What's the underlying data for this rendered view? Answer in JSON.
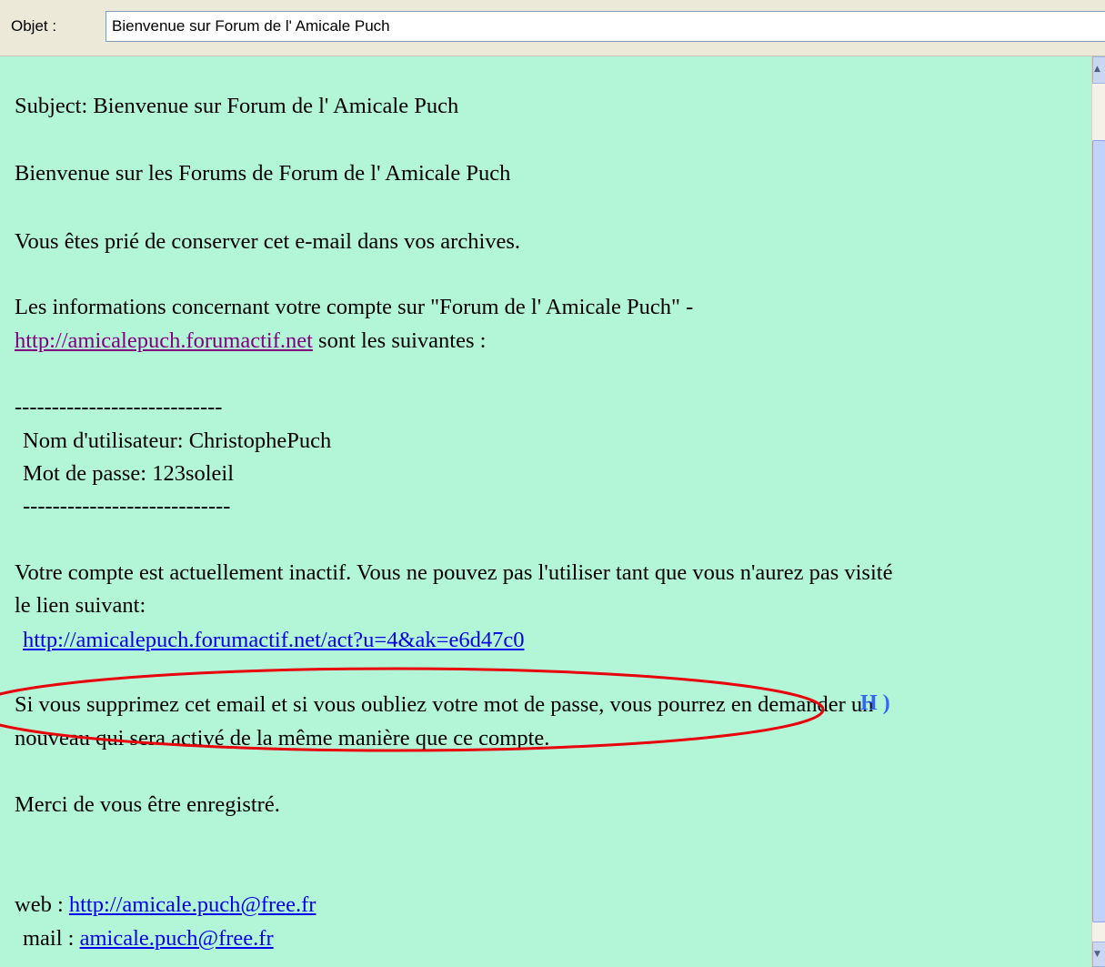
{
  "header": {
    "subject_label": "Objet :",
    "subject_value": "Bienvenue sur Forum de l' Amicale Puch"
  },
  "message": {
    "subject_line": "Subject: Bienvenue sur Forum de l' Amicale Puch",
    "welcome": "Bienvenue sur les Forums de Forum de l' Amicale Puch",
    "keep_notice": "Vous êtes prié de conserver cet e-mail dans vos archives.",
    "account_info_1": "Les informations concernant votre compte sur \"Forum de l' Amicale Puch\" -",
    "account_url": "http://amicalepuch.forumactif.net",
    "account_info_2": " sont les suivantes :",
    "separator_top": "----------------------------",
    "username_line": "Nom d'utilisateur: ChristophePuch",
    "password_line": "Mot de passe: 123soleil",
    "separator_bottom": "----------------------------",
    "inactive_1": "Votre compte est actuellement inactif. Vous ne pouvez pas l'utiliser tant que vous n'aurez pas visité",
    "inactive_2": "le lien suivant:",
    "activation_url": "http://amicalepuch.forumactif.net/act?u=4&ak=e6d47c0",
    "delete_1": "Si vous supprimez cet email et si vous oubliez votre mot de passe, vous pourrez en demander un",
    "delete_2": "nouveau qui sera activé de la même manière que ce compte.",
    "thanks": "Merci de vous être enregistré.",
    "web_label": "web : ",
    "web_url": "http://amicale.puch@free.fr",
    "mail_label": "mail : ",
    "mail_url": "amicale.puch@free.fr"
  },
  "annotation": {
    "label": "H )",
    "color": "#e8000b"
  },
  "colors": {
    "pane_background": "#b3f5d7",
    "link": "#0000ee",
    "visited_link": "#800080",
    "annotation_label": "#3366ff"
  }
}
